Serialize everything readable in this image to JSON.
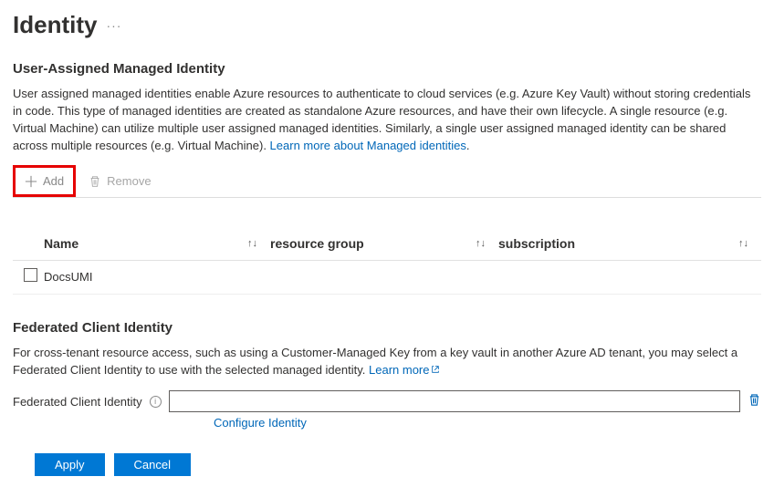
{
  "page": {
    "title": "Identity"
  },
  "uami": {
    "heading": "User-Assigned Managed Identity",
    "description_pre": "User assigned managed identities enable Azure resources to authenticate to cloud services (e.g. Azure Key Vault) without storing credentials in code. This type of managed identities are created as standalone Azure resources, and have their own lifecycle. A single resource (e.g. Virtual Machine) can utilize multiple user assigned managed identities. Similarly, a single user assigned managed identity can be shared across multiple resources (e.g. Virtual Machine). ",
    "learn_more_label": "Learn more about Managed identities",
    "description_post": "."
  },
  "toolbar": {
    "add_label": "Add",
    "remove_label": "Remove"
  },
  "table": {
    "columns": {
      "name": "Name",
      "resource_group": "resource group",
      "subscription": "subscription"
    },
    "rows": [
      {
        "name": "DocsUMI",
        "resource_group": "",
        "subscription": ""
      }
    ]
  },
  "fci": {
    "heading": "Federated Client Identity",
    "description_pre": "For cross-tenant resource access, such as using a Customer-Managed Key from a key vault in another Azure AD tenant, you may select a Federated Client Identity to use with the selected managed identity. ",
    "learn_more_label": "Learn more",
    "field_label": "Federated Client Identity",
    "input_value": "",
    "configure_label": "Configure Identity"
  },
  "buttons": {
    "apply": "Apply",
    "cancel": "Cancel"
  }
}
